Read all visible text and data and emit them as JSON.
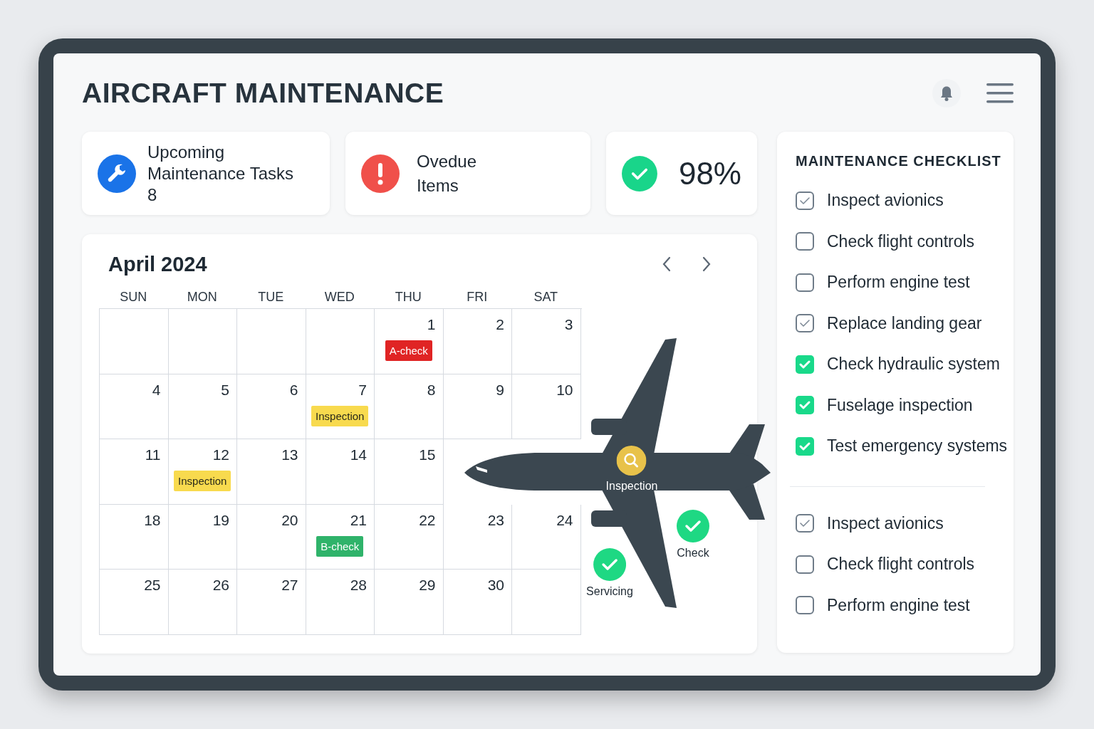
{
  "title": "AIRCRAFT MAINTENANCE",
  "stats": [
    {
      "kind": "wrench",
      "lines": [
        "Upcoming",
        "Maintenance Tasks"
      ],
      "value": "8"
    },
    {
      "kind": "alert",
      "lines": [
        "Ovedue",
        "Items"
      ]
    },
    {
      "kind": "check",
      "value": "98%"
    }
  ],
  "calendar": {
    "month": "April 2024",
    "weekdays": [
      "SUN",
      "MON",
      "TUE",
      "WED",
      "THU",
      "FRI",
      "SAT"
    ],
    "weeks": [
      [
        {
          "kind": "empty"
        },
        {
          "kind": "empty"
        },
        {
          "kind": "empty"
        },
        {
          "kind": "empty"
        },
        {
          "day": "1",
          "event": {
            "label": "A-check",
            "color": "#e02424"
          }
        },
        {
          "day": "2"
        },
        {
          "day": "3"
        }
      ],
      [
        {
          "day": "4"
        },
        {
          "day": "5"
        },
        {
          "day": "6"
        },
        {
          "day": "7",
          "event": {
            "label": "Inspection",
            "color": "#f8da4e"
          }
        },
        {
          "day": "8"
        },
        {
          "day": "9"
        },
        {
          "day": "10"
        }
      ],
      [
        {
          "day": "11"
        },
        {
          "day": "12",
          "event": {
            "label": "Inspection",
            "color": "#f8da4e"
          }
        },
        {
          "day": "13"
        },
        {
          "day": "14"
        },
        {
          "day": "15"
        },
        {
          "kind": "covered"
        },
        {
          "kind": "covered"
        }
      ],
      [
        {
          "day": "18"
        },
        {
          "day": "19"
        },
        {
          "day": "20"
        },
        {
          "day": "21",
          "event": {
            "label": "B-check",
            "color": "#2fb36a"
          }
        },
        {
          "day": "22"
        },
        {
          "day": "23"
        },
        {
          "day": "24"
        }
      ],
      [
        {
          "day": "25"
        },
        {
          "day": "26"
        },
        {
          "day": "27"
        },
        {
          "day": "28"
        },
        {
          "day": "29"
        },
        {
          "day": "30"
        },
        {
          "kind": "empty"
        }
      ]
    ]
  },
  "plane_markers": [
    {
      "kind": "inspection",
      "label": "Inspection"
    },
    {
      "kind": "check",
      "label": "Check"
    },
    {
      "kind": "check",
      "label": "Servicing"
    }
  ],
  "checklist": {
    "title": "MAINTENANCE CHECKLIST",
    "groups": [
      [
        {
          "label": "Inspect avionics",
          "checked": true,
          "confirmed": false
        },
        {
          "label": "Check flight controls",
          "checked": false,
          "confirmed": false
        },
        {
          "label": "Perform engine test",
          "checked": false,
          "confirmed": false
        },
        {
          "label": "Replace landing gear",
          "checked": true,
          "confirmed": false
        },
        {
          "label": "Check hydraulic system",
          "checked": true,
          "confirmed": true
        },
        {
          "label": "Fuselage inspection",
          "checked": true,
          "confirmed": true
        },
        {
          "label": "Test emergency systems",
          "checked": true,
          "confirmed": true
        }
      ],
      [
        {
          "label": "Inspect avionics",
          "checked": true,
          "confirmed": false
        },
        {
          "label": "Check flight controls",
          "checked": false,
          "confirmed": false
        },
        {
          "label": "Perform engine test",
          "checked": false,
          "confirmed": false
        }
      ]
    ]
  }
}
